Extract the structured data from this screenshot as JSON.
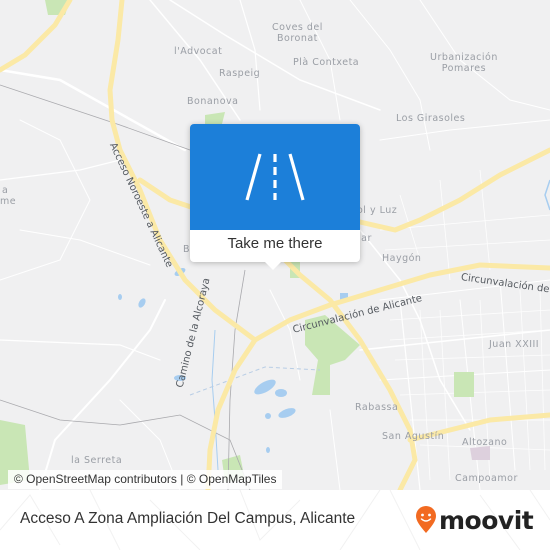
{
  "map": {
    "place_labels": [
      {
        "name": "coves-del-boronat",
        "text": "Coves del\nBoronat"
      },
      {
        "name": "l-advocat",
        "text": "l'Advocat"
      },
      {
        "name": "raspeig",
        "text": "Raspeig"
      },
      {
        "name": "pla-contxeta",
        "text": "Plà Contxeta"
      },
      {
        "name": "urbanizacion-pomares",
        "text": "Urbanización\nPomares"
      },
      {
        "name": "bonanova",
        "text": "Bonanova"
      },
      {
        "name": "los-girasoles",
        "text": "Los Girasoles"
      },
      {
        "name": "sol-y-luz",
        "text": "ol y Luz"
      },
      {
        "name": "lar",
        "text": "lar"
      },
      {
        "name": "haygon",
        "text": "Haygón"
      },
      {
        "name": "juan-xxiii",
        "text": "Juan XXIII"
      },
      {
        "name": "rabassa",
        "text": "Rabassa"
      },
      {
        "name": "san-agustin",
        "text": "San Agustín"
      },
      {
        "name": "altozano",
        "text": "Altozano"
      },
      {
        "name": "campoamor",
        "text": "Campoamor"
      },
      {
        "name": "la-serreta",
        "text": "la Serreta"
      },
      {
        "name": "left-a",
        "text": "a"
      },
      {
        "name": "left-me",
        "text": "me"
      },
      {
        "name": "left-b",
        "text": "B"
      }
    ],
    "street_labels": [
      {
        "name": "acceso-noroeste",
        "text": "Acceso Noroeste a Alicante"
      },
      {
        "name": "camino-alcoraya",
        "text": "Camino de la Alcoraya"
      },
      {
        "name": "circunvalacion-1",
        "text": "Circunvalación de Alicante"
      },
      {
        "name": "circunvalacion-2",
        "text": "Circunvalación de"
      }
    ],
    "colors": {
      "background": "#f0f0f1",
      "major_road": "#fbe9a6",
      "minor_road": "#ffffff",
      "park": "#c9e6b5",
      "water": "#a7cdf0",
      "railway": "#a9a9ad"
    }
  },
  "popup": {
    "icon": "road-icon",
    "cta_label": "Take me there",
    "accent_color": "#1c7fd9"
  },
  "attribution": {
    "text": "© OpenStreetMap contributors | © OpenMapTiles"
  },
  "footer": {
    "title": "Acceso A Zona Ampliación Del Campus, Alicante",
    "brand": "moovit",
    "brand_color": "#f26a21"
  }
}
